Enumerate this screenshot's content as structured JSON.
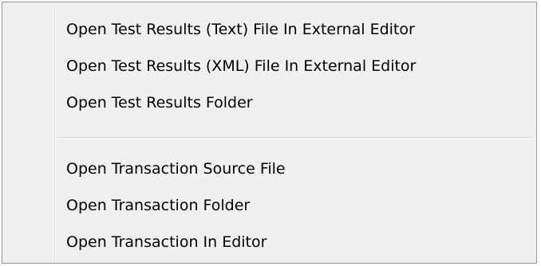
{
  "context_menu": {
    "groups": [
      {
        "items": [
          {
            "label": "Open Test Results (Text) File In External Editor"
          },
          {
            "label": "Open Test Results (XML) File In External Editor"
          },
          {
            "label": "Open Test Results Folder"
          }
        ]
      },
      {
        "items": [
          {
            "label": "Open Transaction Source File"
          },
          {
            "label": "Open Transaction Folder"
          },
          {
            "label": "Open Transaction In Editor"
          }
        ]
      }
    ]
  }
}
